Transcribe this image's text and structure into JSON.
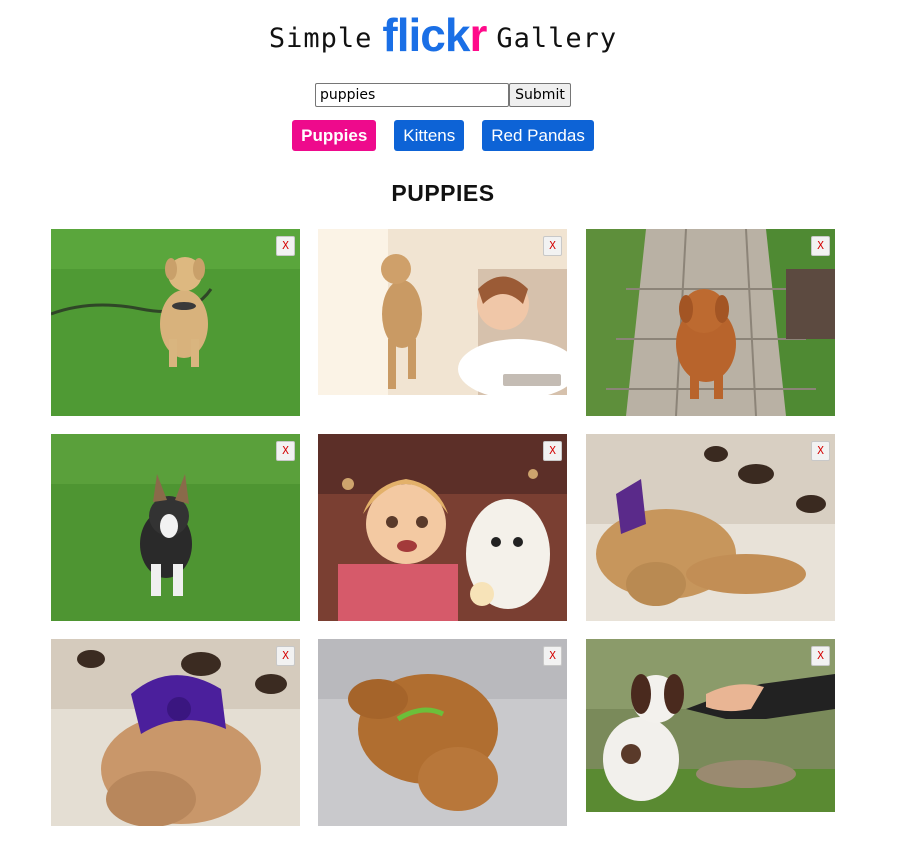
{
  "header": {
    "logo_simple": "Simple",
    "logo_flick": "flick",
    "logo_r": "r",
    "logo_gallery": "Gallery"
  },
  "search": {
    "value": "puppies",
    "submit_label": "Submit"
  },
  "tags": [
    {
      "label": "Puppies",
      "active": true
    },
    {
      "label": "Kittens",
      "active": false
    },
    {
      "label": "Red Pandas",
      "active": false
    }
  ],
  "gallery": {
    "title": "PUPPIES",
    "close_label": "X",
    "photos": [
      {
        "subject": "golden retriever puppy walking on grass"
      },
      {
        "subject": "girl holding chihuahua puppy"
      },
      {
        "subject": "labrador puppy on stone path"
      },
      {
        "subject": "corgi puppy on grass"
      },
      {
        "subject": "cartoon girl with westie and cupcake"
      },
      {
        "subject": "puppy with purple bow on blanket"
      },
      {
        "subject": "puppy with purple ribbon sleeping"
      },
      {
        "subject": "newborn puppy on white sheet"
      },
      {
        "subject": "spaniel puppy giving paw"
      }
    ]
  },
  "colors": {
    "flickr_blue": "#1a6fe6",
    "flickr_pink": "#ff0a8a",
    "tag_blue": "#0d63d6",
    "tag_active": "#ee0a8c",
    "close_x": "#d40000"
  }
}
